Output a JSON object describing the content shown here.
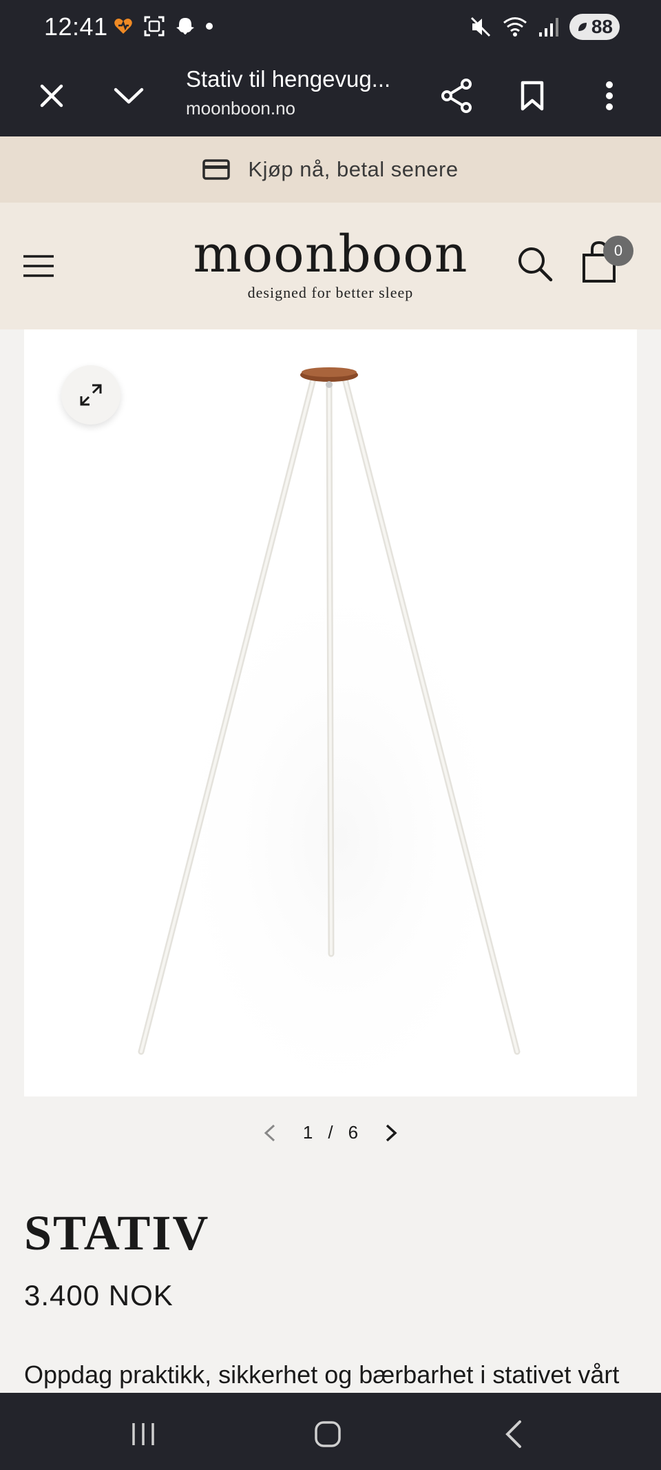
{
  "status_bar": {
    "time": "12:41",
    "battery": "88",
    "icons_left": [
      "heart-icon",
      "screenshot-icon",
      "snapchat-icon",
      "dot-icon"
    ],
    "icons_right": [
      "mute-icon",
      "wifi-icon",
      "signal-icon",
      "battery-icon"
    ]
  },
  "browser": {
    "title": "Stativ til hengevug...",
    "url": "moonboon.no",
    "icons": [
      "close-icon",
      "chevron-down-icon",
      "share-icon",
      "bookmark-icon",
      "more-icon"
    ]
  },
  "promo": {
    "text": "Kjøp nå, betal senere",
    "icon": "credit-card-icon"
  },
  "header": {
    "logo": "moonboon",
    "tagline": "designed for better sleep",
    "cart_count": "0"
  },
  "gallery": {
    "current": "1",
    "separator": "/",
    "total": "6"
  },
  "product": {
    "title": "STATIV",
    "price": "3.400 NOK",
    "description": "Oppdag praktikk, sikkerhet og bærbarhet i stativet vårt"
  },
  "colors": {
    "system_bar": "#23242b",
    "promo_bg": "#e8ddd0",
    "header_bg": "#f0e9e0",
    "page_bg": "#f3f2f0",
    "tripod_wood": "#8a4a28"
  }
}
